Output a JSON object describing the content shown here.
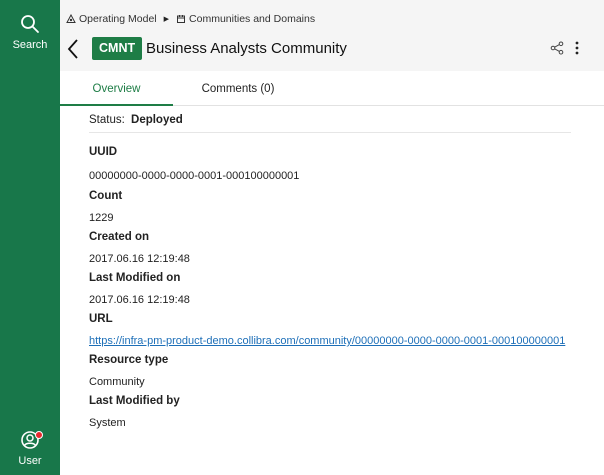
{
  "sidebar": {
    "search_label": "Search",
    "user_label": "User"
  },
  "breadcrumb": {
    "items": [
      "Operating Model",
      "Communities and Domains"
    ]
  },
  "header": {
    "badge": "CMNT",
    "title": "Business Analysts Community"
  },
  "tabs": [
    {
      "label": "Overview",
      "active": true
    },
    {
      "label": "Comments (0)",
      "active": false
    }
  ],
  "status": {
    "label": "Status:",
    "value": "Deployed"
  },
  "fields": [
    {
      "label": "UUID",
      "value": "00000000-0000-0000-0001-000100000001"
    },
    {
      "label": "Count",
      "value": "1229"
    },
    {
      "label": "Created on",
      "value": "2017.06.16 12:19:48"
    },
    {
      "label": "Last Modified on",
      "value": "2017.06.16 12:19:48"
    },
    {
      "label": "URL",
      "value": "https://infra-pm-product-demo.collibra.com/community/00000000-0000-0000-0001-000100000001"
    },
    {
      "label": "Resource type",
      "value": "Community"
    },
    {
      "label": "Last Modified by",
      "value": "System"
    }
  ],
  "colors": {
    "sidebar": "#18774a",
    "accent": "#1e7d46",
    "link": "#1d6fb8",
    "notification": "#e8282e"
  },
  "icons": [
    "search-icon",
    "user-icon",
    "operating-model-icon",
    "community-icon",
    "back-icon",
    "share-icon",
    "more-icon"
  ]
}
